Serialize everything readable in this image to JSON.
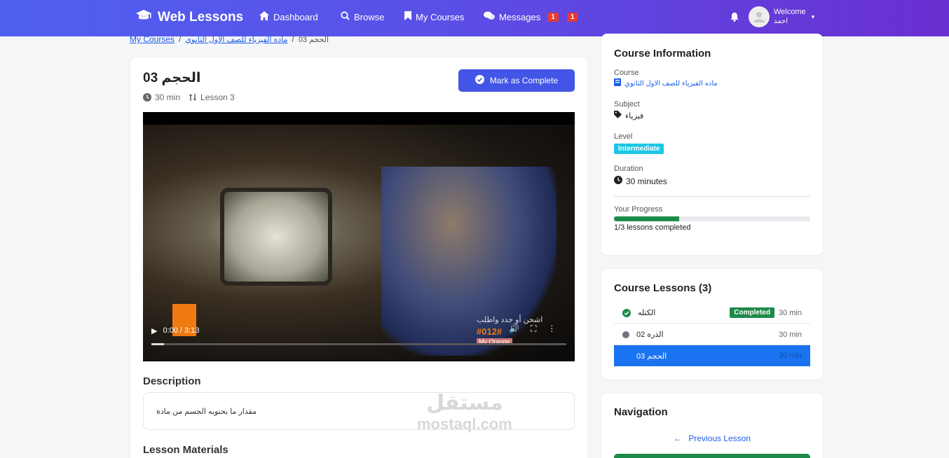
{
  "brand": {
    "name": "Web Lessons"
  },
  "nav": {
    "dashboard": "Dashboard",
    "browse": "Browse",
    "my_courses": "My Courses",
    "messages": "Messages",
    "messages_badge_1": "1",
    "messages_badge_2": "1"
  },
  "user": {
    "welcome": "Welcome",
    "name": "احمد"
  },
  "breadcrumb": {
    "item1": "My Courses",
    "item2": "ماده الفيزياء للصف الاول الثانوي",
    "current": "الحجم 03",
    "sep": "/"
  },
  "lesson": {
    "title": "الحجم 03",
    "duration": "30 min",
    "number": "Lesson 3",
    "complete_button": "Mark as Complete"
  },
  "video": {
    "time": "0:00 / 3:13",
    "progress": 0.0,
    "overlay_text": "اشحن أو جدد واطلب",
    "overlay_code": "#012#",
    "overlay_sub": "My Orange"
  },
  "description": {
    "heading": "Description",
    "text": "مقدار ما يحتويه الجسم من مادة"
  },
  "materials": {
    "heading": "Lesson Materials"
  },
  "watermark": {
    "ar": "مستقل",
    "en": "mostaql.com"
  },
  "course_info": {
    "title": "Course Information",
    "course_label": "Course",
    "course_value": "ماده الفيزياء للصف الاول الثانوي",
    "subject_label": "Subject",
    "subject_value": "فيزياء",
    "level_label": "Level",
    "level_value": "Intermediate",
    "duration_label": "Duration",
    "duration_value": "30 minutes",
    "progress_label": "Your Progress",
    "progress_value": 0.333,
    "progress_text": "1/3 lessons completed"
  },
  "course_lessons": {
    "title": "Course Lessons (3)",
    "items": [
      {
        "name": "الكتله",
        "status": "Completed",
        "duration": "30 min"
      },
      {
        "name": "الذره 02",
        "status": "",
        "duration": "30 min"
      },
      {
        "name": "الحجم 03",
        "status": "current",
        "duration": "30 min"
      }
    ]
  },
  "navigation": {
    "title": "Navigation",
    "prev": "Previous Lesson"
  },
  "colors": {
    "primary": "#4355e6",
    "success": "#1e8a4a",
    "info": "#1cc6e6",
    "active": "#1a73f0",
    "danger": "#e53935"
  }
}
